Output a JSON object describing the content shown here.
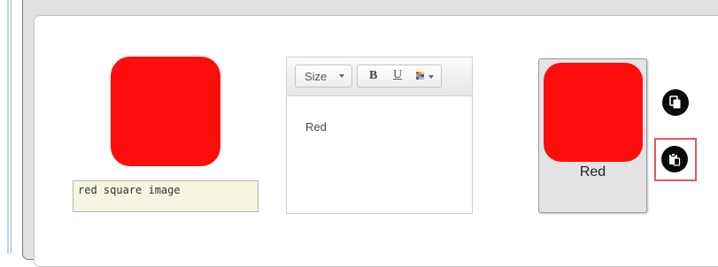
{
  "image_panel": {
    "square_color": "#ff0d0d",
    "caption": "red square image"
  },
  "editor": {
    "toolbar": {
      "size_label": "Size",
      "bold_label": "B",
      "underline_label": "U",
      "color_icon": "color-grid-icon"
    },
    "content": "Red"
  },
  "card": {
    "square_color": "#ff0d0d",
    "label": "Red"
  },
  "actions": {
    "copy_icon": "copy-icon",
    "paste_icon": "paste-icon"
  },
  "colors": {
    "highlight": "#e05a5a",
    "caption_bg": "#f5f5e0"
  }
}
